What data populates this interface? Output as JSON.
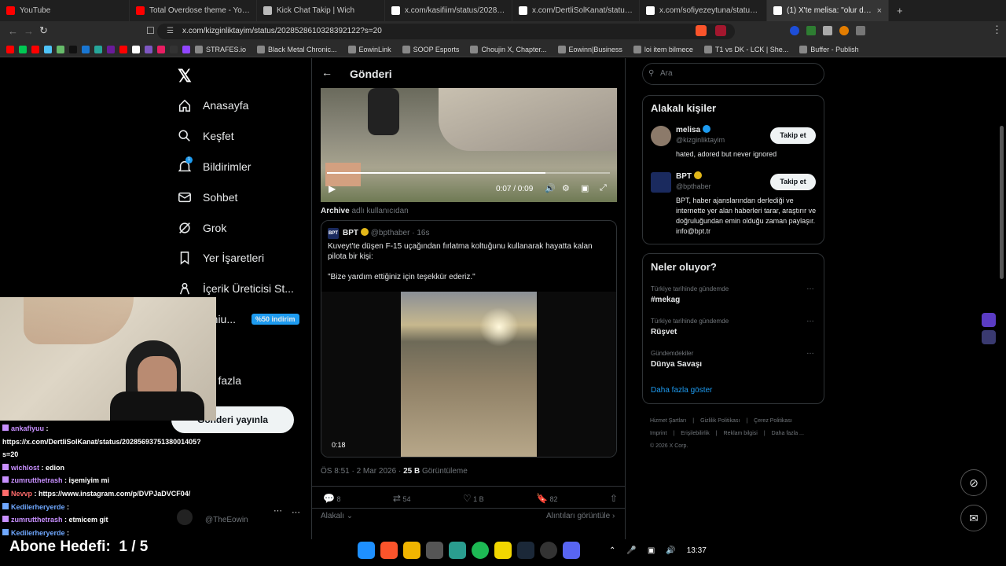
{
  "browser": {
    "tabs": [
      {
        "title": "YouTube",
        "fav_color": "#ff0000"
      },
      {
        "title": "Total Overdose theme - YouTube",
        "fav_color": "#ff0000"
      },
      {
        "title": "Kick Chat Takip | Wich",
        "fav_color": "#bbbbbb"
      },
      {
        "title": "x.com/kasifiim/status/20286127570...",
        "fav_color": "#ffffff"
      },
      {
        "title": "x.com/DertliSolKanat/status/2028569...",
        "fav_color": "#ffffff"
      },
      {
        "title": "x.com/sofiyezeytuna/status/202863...",
        "fav_color": "#ffffff"
      },
      {
        "title": "(1) X'te melisa: \"olur da önümüz...",
        "fav_color": "#ffffff",
        "active": true
      }
    ],
    "url": "x.com/kizginliktayim/status/2028528610328392122?s=20",
    "bookmarks": [
      "STRAFES.io",
      "Black Metal Chronic...",
      "EowinLink",
      "SOOP Esports",
      "Choujin X, Chapter...",
      "Eowinn|Business",
      "loi item bilmece",
      "T1 vs DK - LCK | She...",
      "Buffer - Publish"
    ],
    "colors": {
      "accent": "#1d9bf0",
      "bg": "#000000",
      "border": "#2f3336"
    }
  },
  "sidebar": {
    "items": [
      {
        "label": "Anasayfa",
        "icon": "home-icon"
      },
      {
        "label": "Keşfet",
        "icon": "search-icon"
      },
      {
        "label": "Bildirimler",
        "icon": "bell-icon",
        "badge": "1"
      },
      {
        "label": "Sohbet",
        "icon": "mail-icon"
      },
      {
        "label": "Grok",
        "icon": "grok-icon"
      },
      {
        "label": "Yer İşaretleri",
        "icon": "bookmark-icon"
      },
      {
        "label": "İçerik Üreticisi St...",
        "icon": "creator-icon"
      },
      {
        "label": "emiu...",
        "icon": "premium-icon",
        "promo": "%50 indirim"
      },
      {
        "label": "ofil",
        "icon": "profile-icon"
      },
      {
        "label": "ha fazla",
        "icon": "more-icon"
      }
    ],
    "post_button": "Gönderi yayınla",
    "account_handle": "@TheEowin"
  },
  "post": {
    "header": "Gönderi",
    "video": {
      "time": "0:07 / 0:09"
    },
    "archive_label": "Archive",
    "archive_sub": "adlı kullanıcıdan",
    "quote": {
      "author": "BPT",
      "handle": "@bpthaber",
      "age": "16s",
      "text1": "Kuveyt'te düşen F-15 uçağından fırlatma koltuğunu kullanarak hayatta kalan pilota bir kişi:",
      "text2": "\"Bize yardım ettiğiniz için teşekkür ederiz.\"",
      "video_duration": "0:18"
    },
    "timestamp": "ÖS 8:51 · 2 Mar 2026 ·",
    "views_count": "25 B",
    "views_label": "Görüntüleme",
    "actions": {
      "replies": "8",
      "reposts": "54",
      "likes": "1 B",
      "bookmarks": "82"
    },
    "relevance": "Alakalı",
    "quotes_link": "Alıntıları görüntüle"
  },
  "right": {
    "search_placeholder": "Ara",
    "relevant_title": "Alakalı kişiler",
    "people": [
      {
        "name": "melisa",
        "handle": "@kizginliktayim",
        "bio": "hated, adored but never ignored",
        "follow": "Takip et",
        "badge_color": "#1d9bf0"
      },
      {
        "name": "BPT",
        "handle": "@bpthaber",
        "bio": "BPT, haber ajanslarından derlediği ve internette yer alan haberleri tarar, araştırır ve doğruluğundan emin olduğu zaman paylaşır. info@bpt.tr",
        "follow": "Takip et",
        "badge_color": "#e2b719"
      }
    ],
    "trends_title": "Neler oluyor?",
    "trends": [
      {
        "context": "Türkiye tarihinde gündemde",
        "name": "#mekag"
      },
      {
        "context": "Türkiye tarihinde gündemde",
        "name": "Rüşvet"
      },
      {
        "context": "Gündemdekiler",
        "name": "Dünya Savaşı"
      }
    ],
    "show_more": "Daha fazla göster",
    "footer": [
      "Hizmet Şartları",
      "Gizlilik Politikası",
      "Çerez Politikası",
      "Imprint",
      "Erişilebilirlik",
      "Reklam bilgisi",
      "Daha fazla ..."
    ],
    "copyright": "© 2026 X Corp."
  },
  "stream": {
    "chat": [
      {
        "user": "ankafiyuu",
        "text": "",
        "color": "#c890ff"
      },
      {
        "user": "",
        "text": "https://x.com/DertliSolKanat/status/2028569375138001405?",
        "color": "#ffffff"
      },
      {
        "user": "",
        "text": "s=20",
        "color": "#ffffff"
      },
      {
        "user": "wichlost",
        "text": "edion",
        "color": "#c890ff"
      },
      {
        "user": "zumrutthetrash",
        "text": "işemiyim mi",
        "color": "#c890ff"
      },
      {
        "user": "Nevvp",
        "text": "https://www.instagram.com/p/DVPJaDVCF04/",
        "color": "#ff6b6b"
      },
      {
        "user": "Kedilerheryerde",
        "text": "",
        "color": "#6fa8ff"
      },
      {
        "user": "zumrutthetrash",
        "text": "etmicem git",
        "color": "#c890ff"
      },
      {
        "user": "Kedilerheryerde",
        "text": "",
        "color": "#6fa8ff"
      }
    ],
    "goal_label": "Abone Hedefi:",
    "goal_value": "1 / 5"
  },
  "taskbar": {
    "time": "13:37"
  }
}
